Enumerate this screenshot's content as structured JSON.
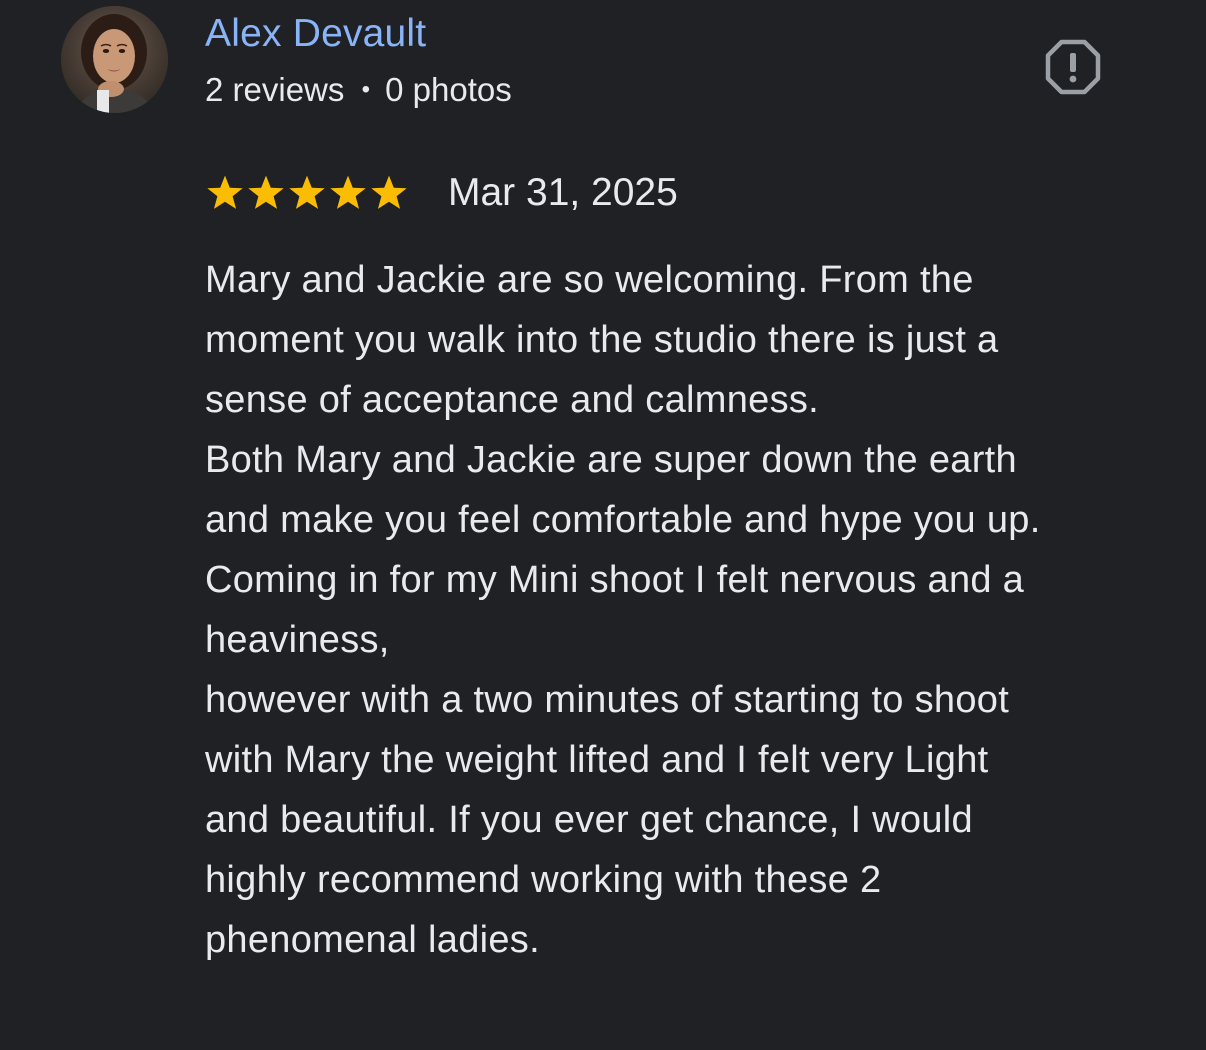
{
  "review": {
    "author": {
      "name": "Alex Devault",
      "reviews_count": "2 reviews",
      "separator": "•",
      "photos_count": "0 photos",
      "avatar_icon": "user-avatar-photo"
    },
    "report_icon": "report-octagon-icon",
    "rating": 5,
    "rating_max": 5,
    "star_color": "#fbbc04",
    "date": "Mar 31, 2025",
    "text_lines": [
      "Mary and Jackie are so welcoming. From the",
      "moment you walk into the studio there is just a",
      "sense of acceptance and calmness.",
      "Both Mary and Jackie are super down the earth",
      "and make you feel comfortable and hype you up.",
      "Coming in for my Mini shoot I felt nervous and a",
      "heaviness,",
      "however with a two minutes of starting to shoot",
      "with Mary the weight lifted and I felt very Light",
      "and beautiful. If you ever get chance, I would",
      "highly recommend working with these 2",
      "phenomenal ladies."
    ]
  },
  "colors": {
    "background": "#202124",
    "author_link": "#8ab4f8",
    "text": "#e8eaed",
    "icon_gray": "#9aa0a6"
  }
}
